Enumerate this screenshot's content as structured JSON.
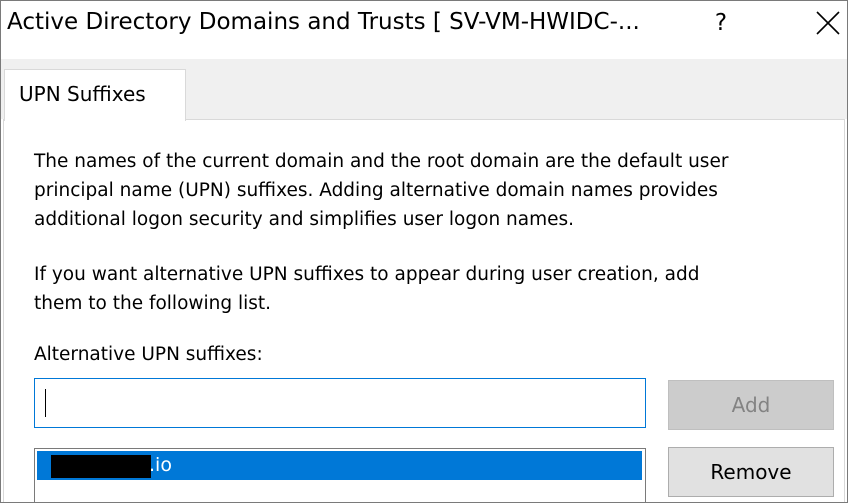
{
  "window": {
    "title": "Active Directory Domains and Trusts [ SV-VM-HWIDC-...",
    "help_label": "?"
  },
  "tabs": [
    {
      "label": "UPN Suffixes",
      "selected": true
    }
  ],
  "content": {
    "paragraph1": "The names of the current domain and the root domain are the default user\nprincipal name (UPN) suffixes. Adding alternative domain names provides\nadditional logon security and simplifies user logon names.",
    "paragraph2": "If you want alternative UPN suffixes to appear during user creation, add\nthem to the following list.",
    "field_label": "Alternative UPN suffixes:",
    "input_value": ""
  },
  "buttons": {
    "add": {
      "label": "Add",
      "enabled": false
    },
    "remove": {
      "label": "Remove",
      "enabled": true
    }
  },
  "suffix_list": {
    "items": [
      {
        "label": ".io",
        "selected": true,
        "redacted": true
      }
    ]
  },
  "colors": {
    "selection": "#0078d7",
    "focus_border": "#0078d7",
    "disabled_button": "#cccccc",
    "tabstrip_bg": "#f0f0f0"
  },
  "icons": {
    "close": "close-icon"
  }
}
